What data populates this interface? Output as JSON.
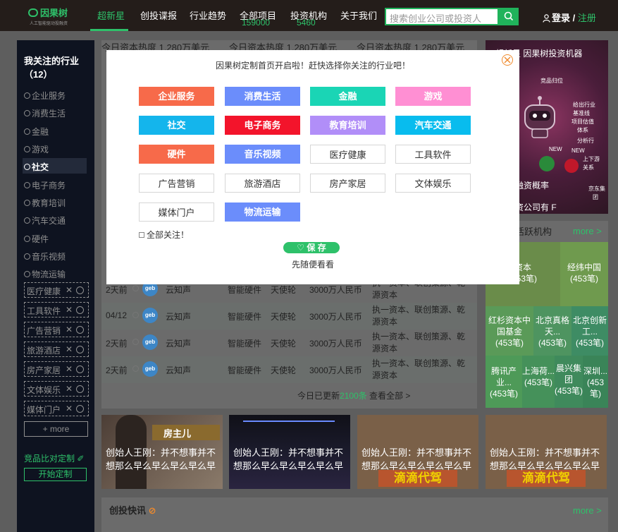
{
  "header": {
    "logo_text": "因果树",
    "logo_sub": "人工智能驱动投融资",
    "nav": [
      "超新星",
      "创投谍报",
      "行业趋势",
      "全部项目",
      "投资机构",
      "关于我们"
    ],
    "nav_counts": {
      "projects": "159000",
      "institutions": "5460"
    },
    "search_placeholder": "搜索创业公司或投资人",
    "login": "登录",
    "separator": "/",
    "register": "注册"
  },
  "sidebar": {
    "title": "我关注的行业（12）",
    "items": [
      "企业服务",
      "消费生活",
      "金融",
      "游戏",
      "社交",
      "电子商务",
      "教育培训",
      "汽车交通",
      "硬件",
      "音乐视频",
      "物流运输"
    ],
    "tags": [
      "医疗健康",
      "工具软件",
      "广告营销",
      "旅游酒店",
      "房产家居",
      "文体娱乐",
      "媒体门户"
    ],
    "more": "+ more",
    "compare_title": "竞品比对定制",
    "start_button": "开始定制"
  },
  "heat": {
    "card1": "今日资本热度 1,280万美元",
    "card2": "今日资本热度 1,280万美元",
    "card3": "今日资本热度 1,280万美元"
  },
  "rows": [
    {
      "time": "2天前",
      "logo": "geb",
      "name": "云知声",
      "industry": "智能硬件",
      "investor_type": "天使轮",
      "amount": "3000万人民币",
      "investors": "执一资本、联创策源、乾源资本"
    },
    {
      "time": "04/12",
      "logo": "geb",
      "name": "云知声",
      "industry": "智能硬件",
      "investor_type": "天使轮",
      "amount": "3000万人民币",
      "investors": "执一资本、联创策源、乾源资本"
    },
    {
      "time": "2天前",
      "logo": "geb",
      "name": "云知声",
      "industry": "智能硬件",
      "investor_type": "天使轮",
      "amount": "3000万人民币",
      "investors": "执一资本、联创策源、乾源资本"
    },
    {
      "time": "2天前",
      "logo": "geb",
      "name": "云知声",
      "industry": "智能硬件",
      "investor_type": "天使轮",
      "amount": "3000万人民币",
      "investors": "执一资本、联创策源、乾源资本"
    }
  ],
  "today": {
    "prefix": "今日已更新",
    "count": "2100条",
    "suffix": " 查看全部 >"
  },
  "robot": {
    "title": "超新星 因果树投资机器",
    "labels": [
      "竞品归位",
      "给出行业",
      "基准线",
      "项目估值",
      "体系",
      "分析行",
      "NEW",
      "NEW",
      "上下游",
      "关系",
      "京东集",
      "团"
    ],
    "line1": "功预测融资概率",
    "line2": "预测融资公司有 F"
  },
  "active": {
    "title": "活跃机构",
    "more": "more >",
    "cells": [
      {
        "name": "资本",
        "count": "(453笔)"
      },
      {
        "name": "经纬中国",
        "count": "(453笔)"
      },
      {
        "name": "红杉资本中国基金",
        "count": "(453笔)"
      },
      {
        "name": "北京真格天...",
        "count": "(453笔)"
      },
      {
        "name": "北京创新工...",
        "count": "(453笔)"
      },
      {
        "name": "腾讯产业...",
        "count": "(453笔)"
      },
      {
        "name": "上海荷...",
        "count": "(453笔)"
      },
      {
        "name": "晨兴集团",
        "count": "(453笔)"
      },
      {
        "name": "深圳...",
        "count": "(453笔)"
      }
    ]
  },
  "news": [
    {
      "caption": "创始人王刚：并不想事并不想那么早么早么早么早么早",
      "brand": "房主儿"
    },
    {
      "caption": "创始人王刚：并不想事并不想那么早么早么早么早么早",
      "brand": ""
    },
    {
      "caption": "创始人王刚：并不想事并不想那么早么早么早么早么早",
      "brand": "滴滴代驾"
    },
    {
      "caption": "创始人王刚：并不想事并不想那么早么早么早么早么早",
      "brand": "滴滴代驾"
    }
  ],
  "quick": {
    "title": "创投快讯",
    "more": "more >"
  },
  "modal": {
    "title": "因果树定制首页开启啦！赶快选择你关注的行业吧！",
    "tags": [
      {
        "label": "企业服务",
        "color": "#f76a4a",
        "selected": true
      },
      {
        "label": "消费生活",
        "color": "#6b8dfb",
        "selected": true
      },
      {
        "label": "金融",
        "color": "#1ad5b5",
        "selected": true
      },
      {
        "label": "游戏",
        "color": "#ff8fd3",
        "selected": true
      },
      {
        "label": "社交",
        "color": "#14b5ec",
        "selected": true
      },
      {
        "label": "电子商务",
        "color": "#f3142b",
        "selected": true
      },
      {
        "label": "教育培训",
        "color": "#b18ef8",
        "selected": true
      },
      {
        "label": "汽车交通",
        "color": "#08bcee",
        "selected": true
      },
      {
        "label": "硬件",
        "color": "#f76a4a",
        "selected": true
      },
      {
        "label": "音乐视频",
        "color": "#6b8dfb",
        "selected": true
      },
      {
        "label": "医疗健康",
        "color": "#ffffff",
        "selected": false
      },
      {
        "label": "工具软件",
        "color": "#ffffff",
        "selected": false
      },
      {
        "label": "广告营销",
        "color": "#ffffff",
        "selected": false
      },
      {
        "label": "旅游酒店",
        "color": "#ffffff",
        "selected": false
      },
      {
        "label": "房产家居",
        "color": "#ffffff",
        "selected": false
      },
      {
        "label": "文体娱乐",
        "color": "#ffffff",
        "selected": false
      },
      {
        "label": "媒体门户",
        "color": "#ffffff",
        "selected": false
      },
      {
        "label": "物流运输",
        "color": "#6b8dfb",
        "selected": true
      }
    ],
    "all_follow": "全部关注！",
    "save": "保 存",
    "skip": "先随便看看"
  },
  "colors": {
    "accent": "#2ec16a",
    "close": "#f08a2c"
  }
}
